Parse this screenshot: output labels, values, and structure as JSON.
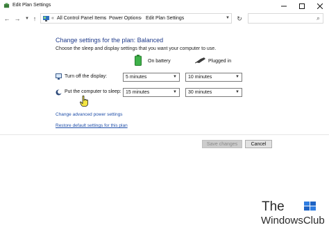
{
  "window": {
    "title": "Edit Plan Settings",
    "controls": [
      "minimize-icon",
      "maximize-icon",
      "close-icon"
    ]
  },
  "address_bar": {
    "breadcrumbs": [
      "All Control Panel Items",
      "Power Options",
      "Edit Plan Settings"
    ],
    "overflow": "«",
    "search_placeholder": ""
  },
  "plan": {
    "heading": "Change settings for the plan: Balanced",
    "subtext": "Choose the sleep and display settings that you want your computer to use.",
    "columns": {
      "battery": "On battery",
      "plugged": "Plugged in"
    },
    "rows": [
      {
        "label": "Turn off the display:",
        "battery": "5 minutes",
        "plugged": "10 minutes",
        "icon": "display-icon"
      },
      {
        "label": "Put the computer to sleep:",
        "battery": "15 minutes",
        "plugged": "30 minutes",
        "icon": "moon-icon"
      }
    ]
  },
  "links": {
    "advanced": "Change advanced power settings",
    "restore": "Restore default settings for this plan"
  },
  "buttons": {
    "save": "Save changes",
    "cancel": "Cancel"
  },
  "watermark": {
    "line1": "The",
    "line2": "WindowsClub"
  },
  "colors": {
    "heading": "#1e3a8a",
    "link": "#1f4ea8",
    "battery_green": "#3fb24a"
  }
}
